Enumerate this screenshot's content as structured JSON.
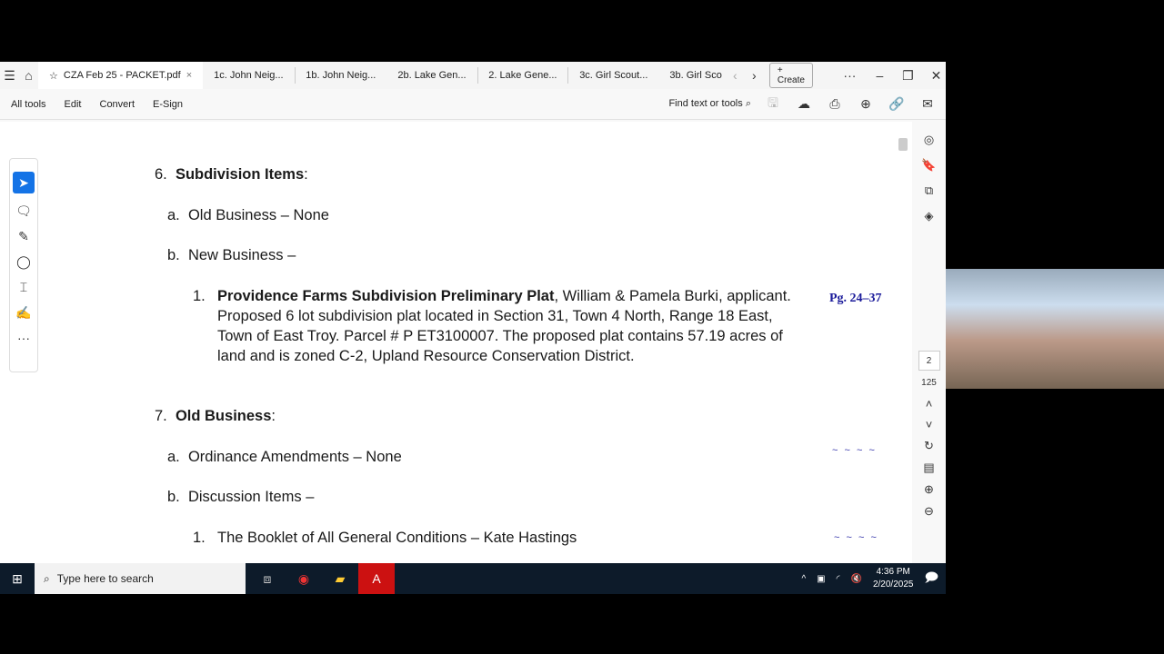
{
  "tabs": [
    {
      "label": "CZA Feb 25 - PACKET.pdf"
    },
    {
      "label": "1c. John Neig..."
    },
    {
      "label": "1b. John Neig..."
    },
    {
      "label": "2b. Lake Gen..."
    },
    {
      "label": "2. Lake Gene..."
    },
    {
      "label": "3c. Girl Scout..."
    },
    {
      "label": "3b. Girl Sco"
    }
  ],
  "create": "Create",
  "menu": [
    "All tools",
    "Edit",
    "Convert",
    "E-Sign"
  ],
  "find": "Find text or tools",
  "doc": {
    "s6": {
      "num": "6.",
      "title": "Subdivision Items",
      "colon": ":"
    },
    "a1": {
      "num": "a.",
      "text": "Old Business – None"
    },
    "b1": {
      "num": "b.",
      "text": "New Business –"
    },
    "i1": {
      "num": "1.",
      "bold": "Providence Farms Subdivision Preliminary Plat",
      "rest": ", William & Pamela Burki, applicant. Proposed 6 lot subdivision plat located in Section 31, Town 4 North, Range 18 East, Town of East Troy. Parcel # P ET3100007. The proposed plat contains 57.19 acres of land and is zoned C-2, Upland Resource Conservation District."
    },
    "pg": "Pg. 24–37",
    "s7": {
      "num": "7.",
      "title": "Old Business",
      "colon": ":"
    },
    "a2": {
      "num": "a.",
      "text": "Ordinance Amendments – None"
    },
    "b2": {
      "num": "b.",
      "text": "Discussion Items –"
    },
    "i2": {
      "num": "1.",
      "text": "The Booklet of All General Conditions – Kate Hastings"
    },
    "tilde": "~ ~ ~ ~"
  },
  "page": {
    "current": "2",
    "total": "125"
  },
  "taskbar": {
    "search": "Type here to search",
    "time": "4:36 PM",
    "date": "2/20/2025"
  }
}
